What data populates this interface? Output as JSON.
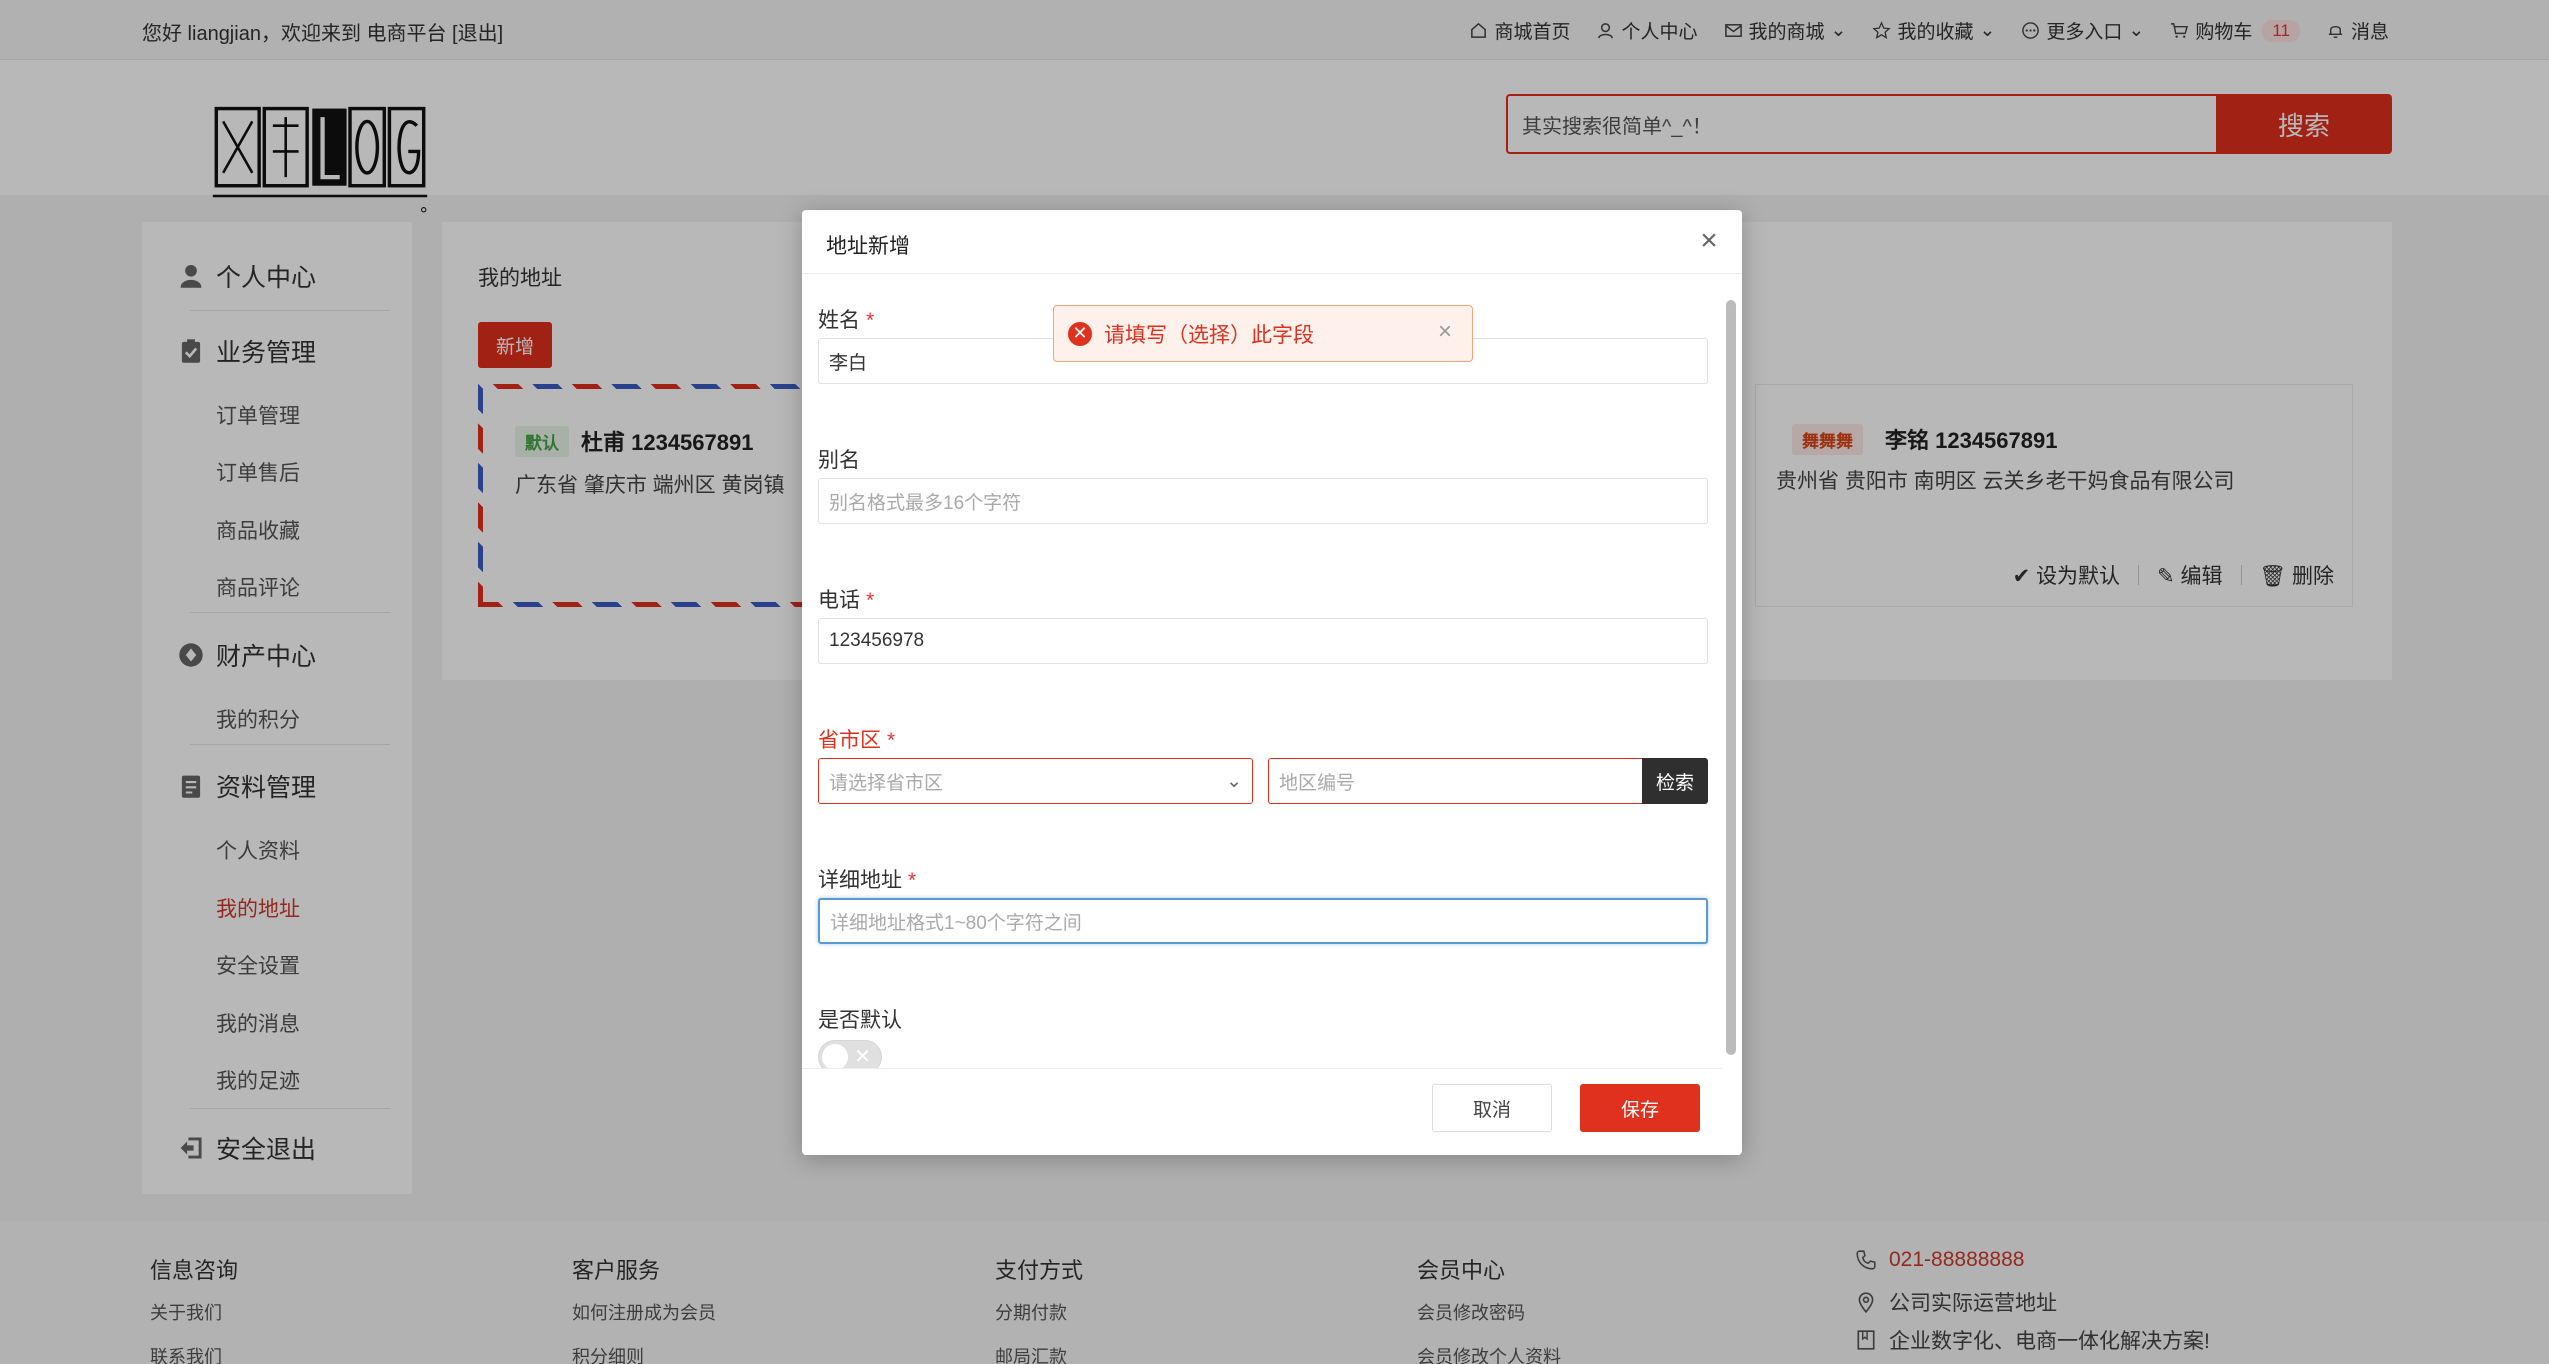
{
  "topbar": {
    "greeting": "您好 liangjian，欢迎来到 电商平台 [退出]",
    "nav": [
      {
        "label": "商城首页",
        "icon": "home-icon"
      },
      {
        "label": "个人中心",
        "icon": "user-icon"
      },
      {
        "label": "我的商城",
        "icon": "mail-icon"
      },
      {
        "label": "我的收藏",
        "icon": "star-icon"
      },
      {
        "label": "更多入口",
        "icon": "more-icon"
      },
      {
        "label": "购物车",
        "icon": "cart-icon",
        "badge": "11"
      },
      {
        "label": "消息",
        "icon": "bell-icon"
      }
    ]
  },
  "header": {
    "search_placeholder": "其实搜索很简单^_^！",
    "search_button": "搜索"
  },
  "sidebar": {
    "personal_center": "个人中心",
    "business": "业务管理",
    "business_items": [
      "订单管理",
      "订单售后",
      "商品收藏",
      "商品评论"
    ],
    "finance": "财产中心",
    "finance_items": [
      "我的积分"
    ],
    "profile": "资料管理",
    "profile_items": [
      "个人资料",
      "我的地址",
      "安全设置",
      "我的消息",
      "我的足迹"
    ],
    "logout": "安全退出"
  },
  "content": {
    "title": "我的地址",
    "add_button": "新增",
    "card_default": {
      "tag": "默认",
      "name": "杜甫 1234567891",
      "address": "广东省 肇庆市 端州区 黄岗镇"
    },
    "card_other": {
      "tag": "舞舞舞",
      "name": "李铭 1234567891",
      "address": "贵州省 贵阳市 南明区 云关乡老干妈食品有限公司"
    },
    "actions": {
      "set_default": "设为默认",
      "edit": "编辑",
      "delete": "删除"
    }
  },
  "dialog": {
    "title": "地址新增",
    "name_label": "姓名",
    "name_value": "李白",
    "alias_label": "别名",
    "alias_placeholder": "别名格式最多16个字符",
    "phone_label": "电话",
    "phone_value": "123456978",
    "region_label": "省市区",
    "region_placeholder": "请选择省市区",
    "code_placeholder": "地区编号",
    "code_button": "检索",
    "detail_label": "详细地址",
    "detail_placeholder": "详细地址格式1~80个字符之间",
    "default_label": "是否默认",
    "cancel": "取消",
    "save": "保存",
    "tooltip": "请填写（选择）此字段"
  },
  "footer": {
    "col1": {
      "title": "信息咨询",
      "links": [
        "关于我们",
        "联系我们"
      ]
    },
    "col2": {
      "title": "客户服务",
      "links": [
        "如何注册成为会员",
        "积分细则"
      ]
    },
    "col3": {
      "title": "支付方式",
      "links": [
        "分期付款",
        "邮局汇款"
      ]
    },
    "col4": {
      "title": "会员中心",
      "links": [
        "会员修改密码",
        "会员修改个人资料"
      ]
    },
    "phone": "021-88888888",
    "address": "公司实际运营地址",
    "slogan": "企业数字化、电商一体化解决方案!"
  },
  "colors": {
    "accent": "#e0301e",
    "tooltip_bg": "#fef0ea",
    "focus": "#5b9bd5"
  }
}
